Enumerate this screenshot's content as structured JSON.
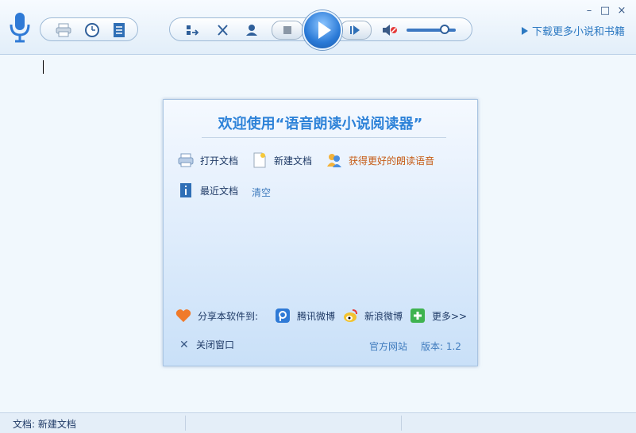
{
  "toolbar": {
    "download_link": "下载更多小说和书籍",
    "minimize": "–",
    "maximize": "□",
    "close": "×"
  },
  "welcome": {
    "title": "欢迎使用“语音朗读小说阅读器”",
    "open_doc": "打开文档",
    "new_doc": "新建文档",
    "get_voice": "获得更好的朗读语音",
    "recent_docs": "最近文档",
    "clear": "清空",
    "share_label": "分享本软件到:",
    "tencent_weibo": "腾讯微博",
    "sina_weibo": "新浪微博",
    "more": "更多>>",
    "close_window": "关闭窗口",
    "official_site": "官方网站",
    "version": "版本: 1.2"
  },
  "status": {
    "document": "文档: 新建文档"
  },
  "colors": {
    "accent": "#2d82d8",
    "link": "#2c79c2",
    "orange": "#c65a14"
  }
}
